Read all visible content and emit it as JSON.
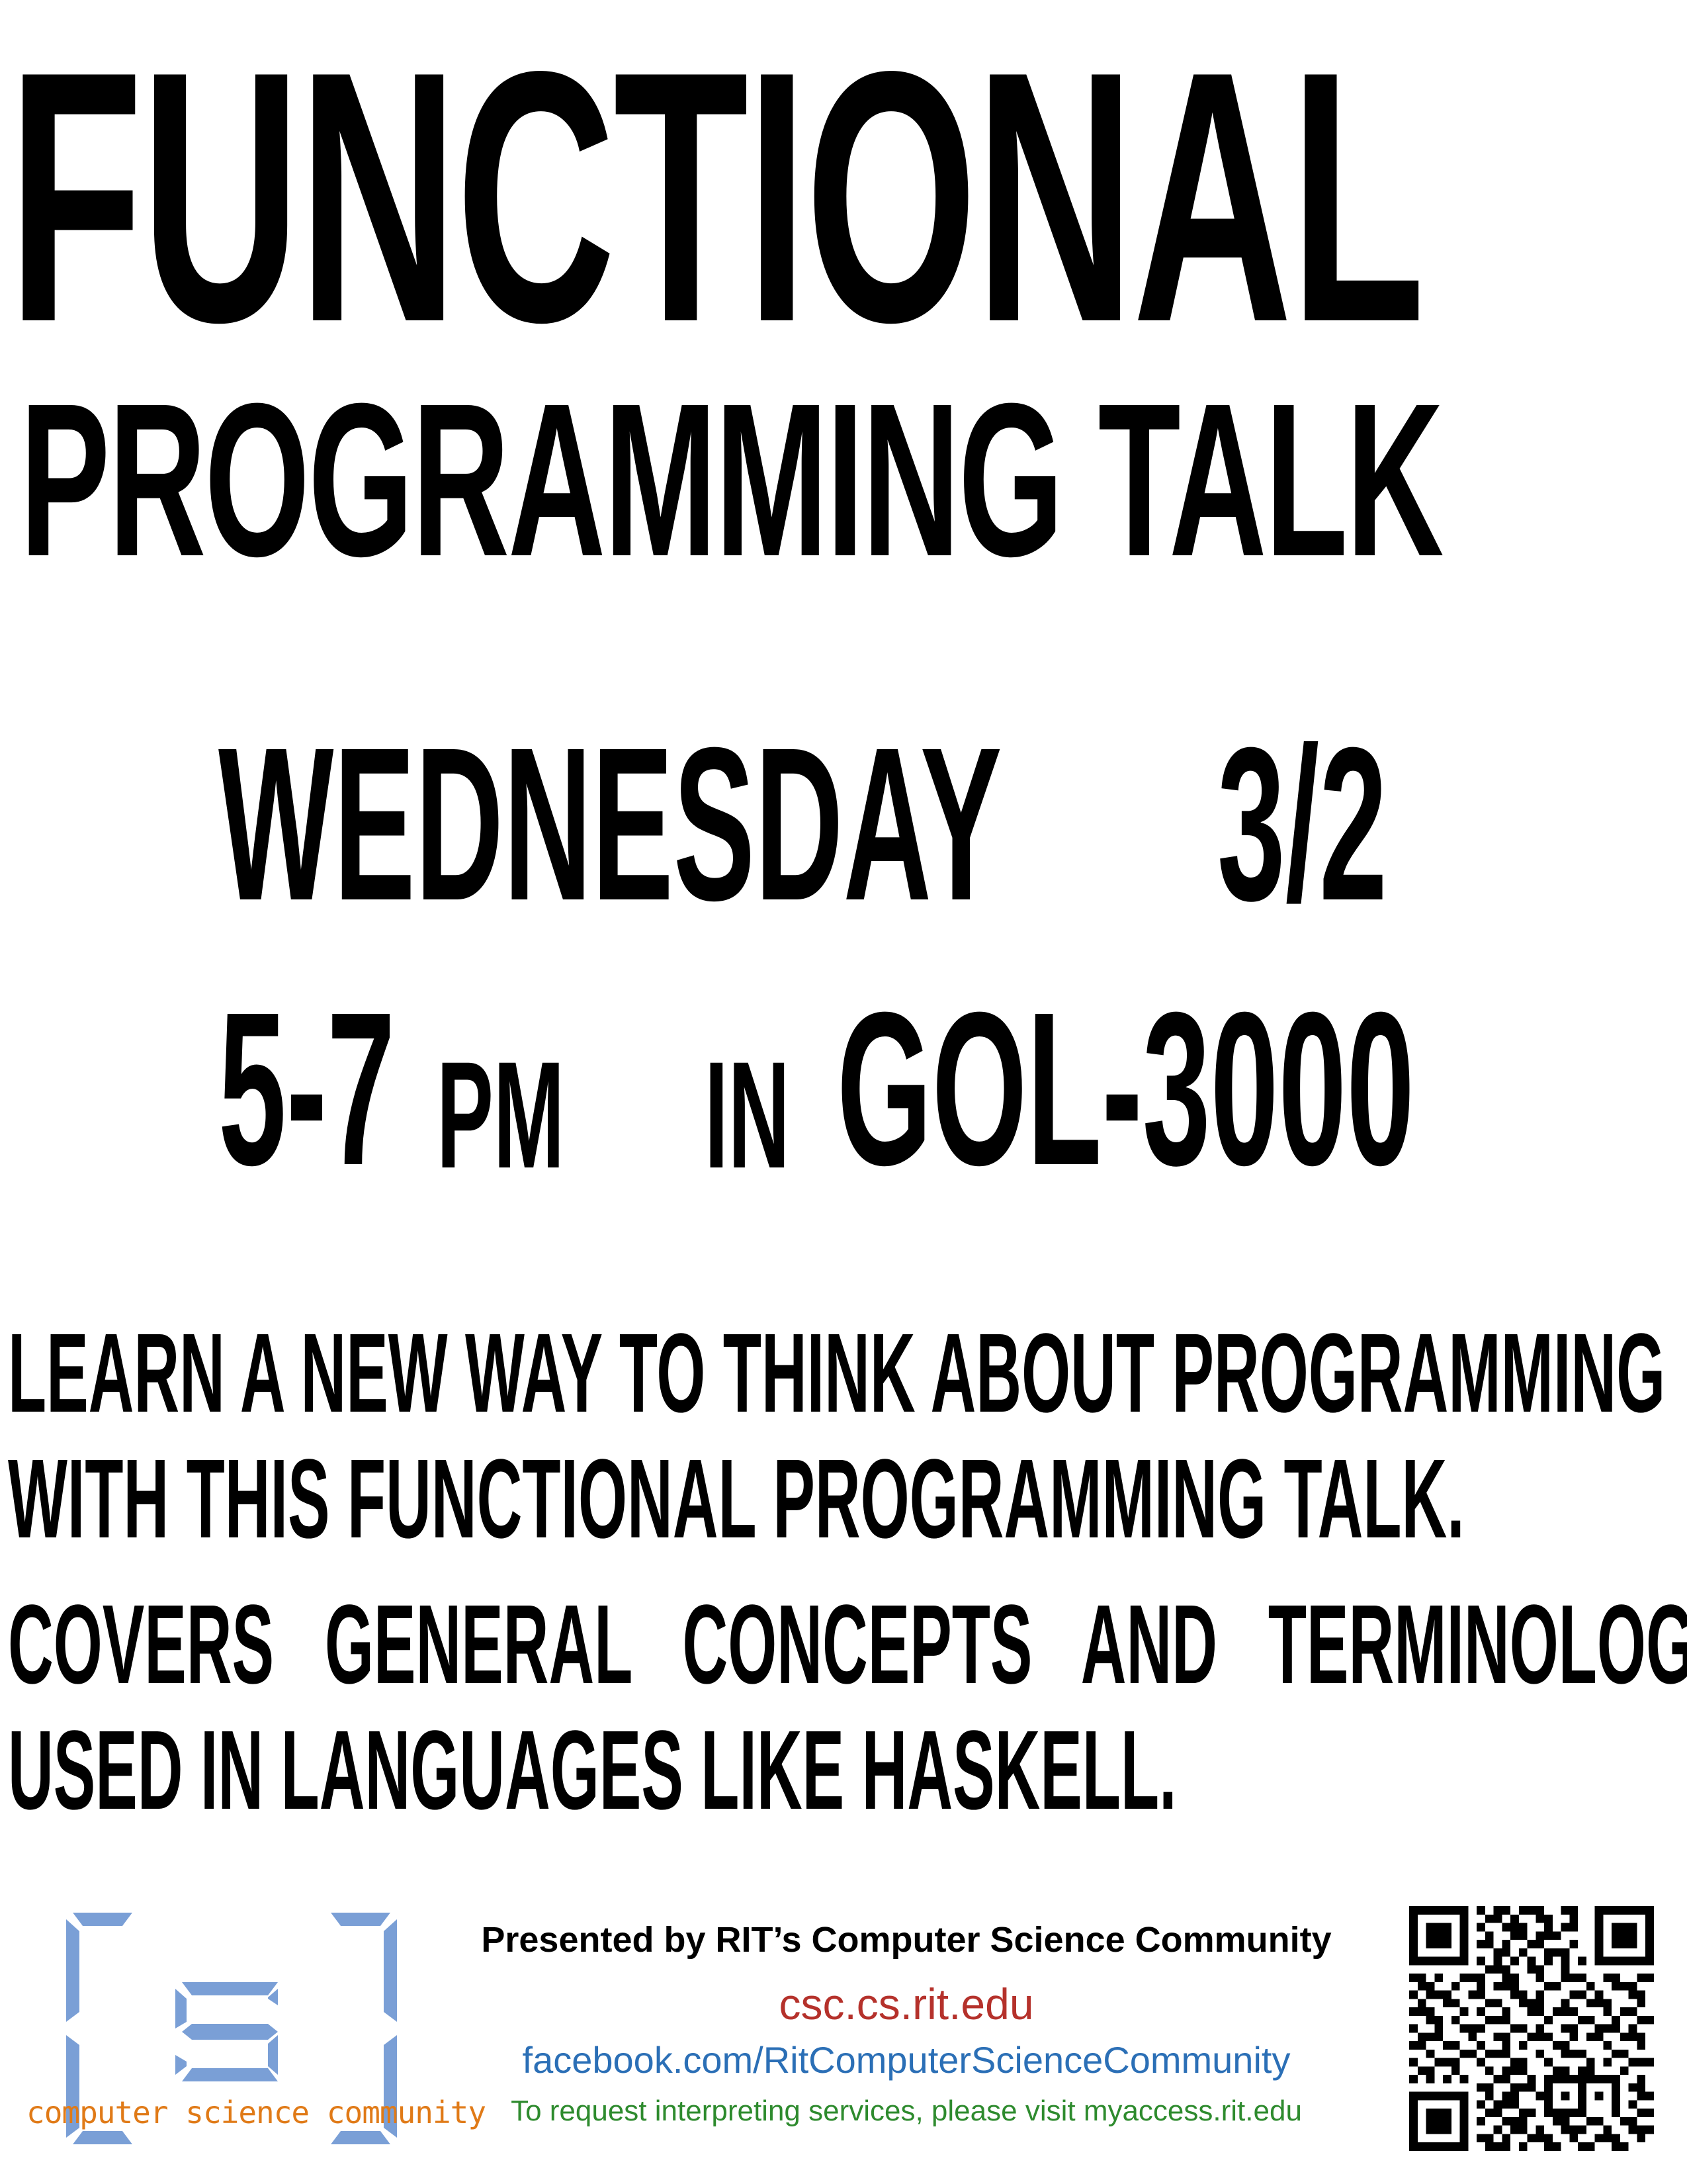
{
  "poster": {
    "title_line1": "FUNCTIONAL",
    "title_line2": "PROGRAMMING TALK",
    "day": "WEDNESDAY",
    "date": "3/2",
    "time": "5-7",
    "time_suffix": "PM",
    "in_word": "IN",
    "room": "GOL-3000",
    "description": [
      "LEARN A NEW WAY TO THINK ABOUT PROGRAMMING",
      "WITH THIS FUNCTIONAL PROGRAMMING TALK.",
      "COVERS GENERAL CONCEPTS AND TERMINOLOGY",
      "USED IN LANGUAGES LIKE HASKELL."
    ]
  },
  "footer": {
    "logo_text": "computer science community",
    "presented_by": "Presented by RIT’s Computer Science Community",
    "website": "csc.cs.rit.edu",
    "facebook": "facebook.com/RitComputerScienceCommunity",
    "access_note": "To request interpreting services, please visit myaccess.rit.edu",
    "qr_icon": "qr-code-icon",
    "logo_icon": "csc-logo-icon"
  },
  "colors": {
    "logo_blue": "#7a9fd6",
    "logo_text": "#e07a17",
    "website": "#b5312b",
    "facebook": "#2b6fb6",
    "access": "#2e8b2e"
  }
}
